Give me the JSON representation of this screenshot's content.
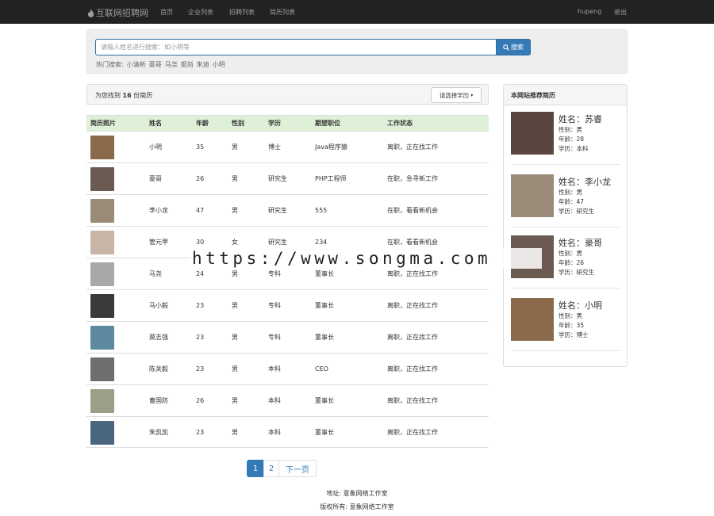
{
  "navbar": {
    "brand": "互联网招聘网",
    "links": [
      "首页",
      "企业列表",
      "招聘列表",
      "简历列表"
    ],
    "user": "hupeng",
    "logout": "退出"
  },
  "search": {
    "placeholder": "请输入姓名进行搜索：如小明等",
    "button": "搜索",
    "hot_label": "热门搜索:",
    "hot_terms": [
      "小清新",
      "豪哥",
      "马尧",
      "姬尚",
      "朱迪",
      "小明"
    ]
  },
  "results": {
    "prefix": "为您找到",
    "count": "16",
    "suffix": "份简历",
    "filter_label": "请选择学历"
  },
  "table": {
    "headers": [
      "简历照片",
      "姓名",
      "年龄",
      "性别",
      "学历",
      "期望职位",
      "工作状态"
    ],
    "rows": [
      {
        "name": "小明",
        "age": "35",
        "gender": "男",
        "edu": "博士",
        "job": "Java程序猿",
        "status": "离职，正在找工作",
        "photo": "#8a6a4a"
      },
      {
        "name": "豪哥",
        "age": "26",
        "gender": "男",
        "edu": "研究生",
        "job": "PHP工程师",
        "status": "在职，急寻新工作",
        "photo": "#6b5a52"
      },
      {
        "name": "李小龙",
        "age": "47",
        "gender": "男",
        "edu": "研究生",
        "job": "555",
        "status": "在职，看看新机会",
        "photo": "#9a8a78"
      },
      {
        "name": "管元甲",
        "age": "30",
        "gender": "女",
        "edu": "研究生",
        "job": "234",
        "status": "在职，看看新机会",
        "photo": "#c9b4a8"
      },
      {
        "name": "马尧",
        "age": "24",
        "gender": "男",
        "edu": "专科",
        "job": "董事长",
        "status": "离职，正在找工作",
        "photo": "#a8a8a8"
      },
      {
        "name": "马小毅",
        "age": "23",
        "gender": "男",
        "edu": "专科",
        "job": "董事长",
        "status": "离职，正在找工作",
        "photo": "#3a3a3a"
      },
      {
        "name": "莫志强",
        "age": "23",
        "gender": "男",
        "edu": "专科",
        "job": "董事长",
        "status": "离职，正在找工作",
        "photo": "#5d8aa0"
      },
      {
        "name": "陈关毅",
        "age": "23",
        "gender": "男",
        "edu": "本科",
        "job": "CEO",
        "status": "离职，正在找工作",
        "photo": "#6e6e6e"
      },
      {
        "name": "曹国防",
        "age": "26",
        "gender": "男",
        "edu": "本科",
        "job": "董事长",
        "status": "离职，正在找工作",
        "photo": "#9aa088"
      },
      {
        "name": "朱凯凯",
        "age": "23",
        "gender": "男",
        "edu": "本科",
        "job": "董事长",
        "status": "离职，正在找工作",
        "photo": "#4a6680"
      }
    ]
  },
  "pagination": {
    "pages": [
      "1",
      "2"
    ],
    "next": "下一页"
  },
  "footer": {
    "address": "地址: 意象网络工作室",
    "copyright": "版权所有: 意象网络工作室"
  },
  "sidebar": {
    "title": "本网站推荐简历",
    "items": [
      {
        "name": "姓名：苏睿",
        "gender": "性别：男",
        "age": "年龄：28",
        "edu": "学历：本科",
        "photo": "#5a4640"
      },
      {
        "name": "姓名：李小龙",
        "gender": "性别：男",
        "age": "年龄：47",
        "edu": "学历：研究生",
        "photo": "#9a8a78"
      },
      {
        "name": "姓名：豪哥",
        "gender": "性别：男",
        "age": "年龄：26",
        "edu": "学历：研究生",
        "photo": "#6b5a52"
      },
      {
        "name": "姓名：小明",
        "gender": "性别：男",
        "age": "年龄：35",
        "edu": "学历：博士",
        "photo": "#8a6a4a"
      }
    ]
  },
  "watermark": "https://www.songma.com"
}
